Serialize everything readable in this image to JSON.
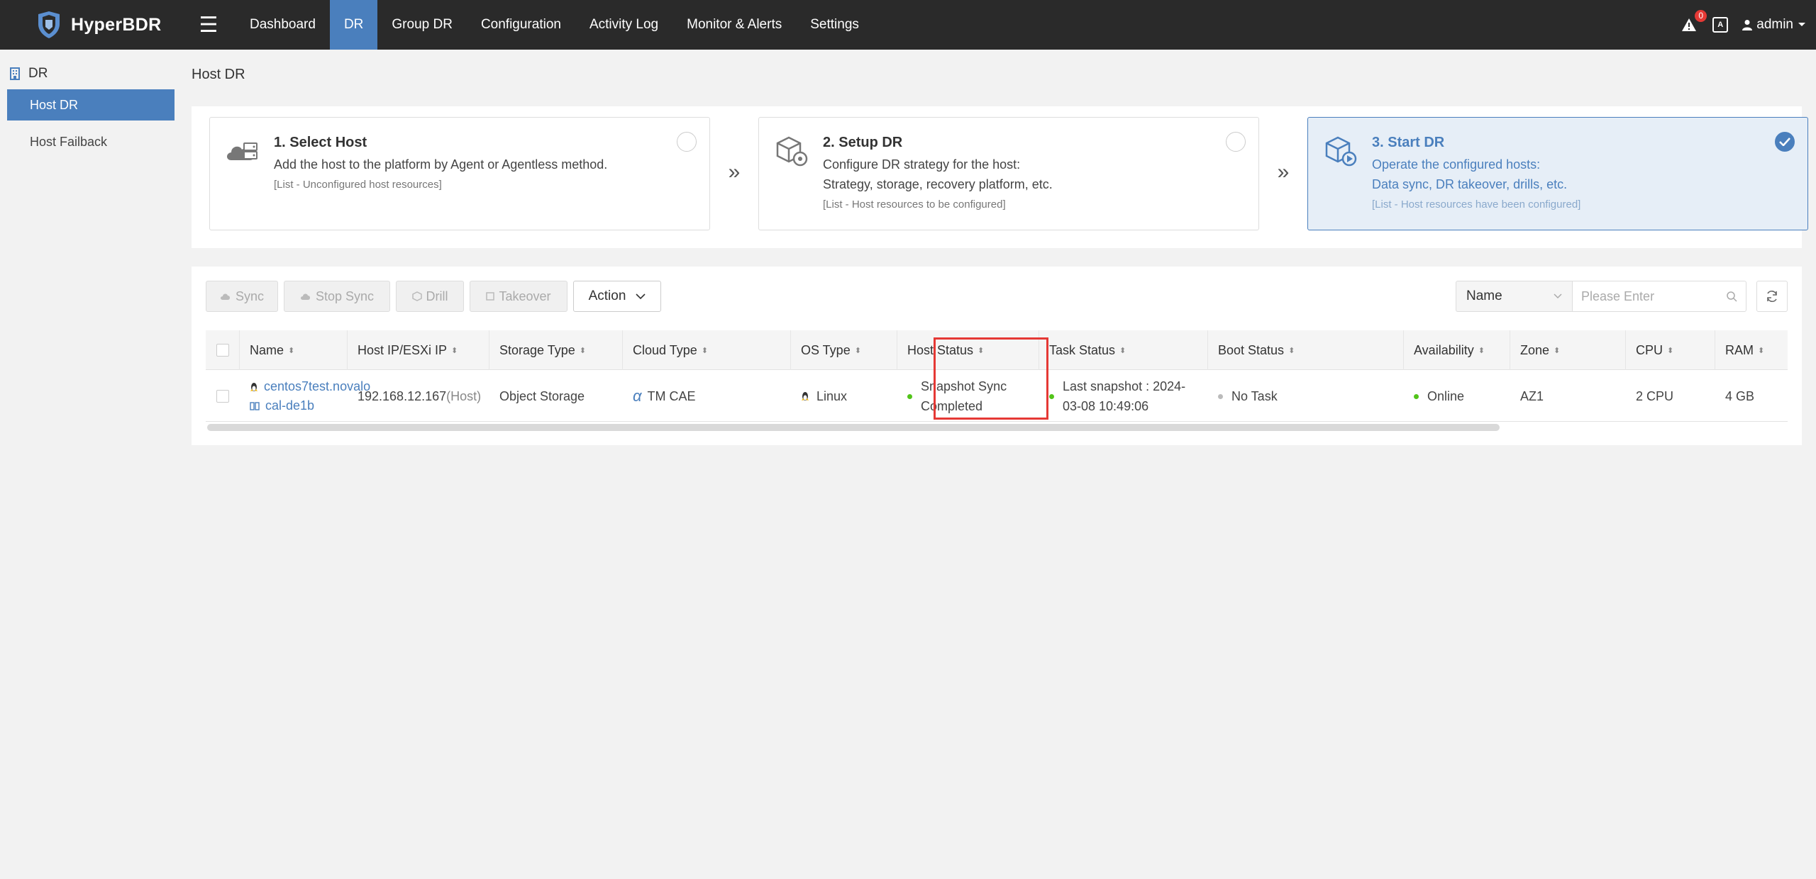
{
  "app": {
    "name": "HyperBDR"
  },
  "nav": {
    "items": [
      {
        "label": "Dashboard",
        "active": false
      },
      {
        "label": "DR",
        "active": true
      },
      {
        "label": "Group DR",
        "active": false
      },
      {
        "label": "Configuration",
        "active": false
      },
      {
        "label": "Activity Log",
        "active": false
      },
      {
        "label": "Monitor & Alerts",
        "active": false
      },
      {
        "label": "Settings",
        "active": false
      }
    ]
  },
  "topbar": {
    "alert_count": "0",
    "lang_icon": "A",
    "user": "admin"
  },
  "sidebar": {
    "section": "DR",
    "items": [
      {
        "label": "Host DR",
        "active": true
      },
      {
        "label": "Host Failback",
        "active": false
      }
    ]
  },
  "page": {
    "title": "Host DR"
  },
  "steps": [
    {
      "title": "1. Select Host",
      "desc1": "Add the host to the platform by Agent or Agentless method.",
      "desc2": "",
      "note": "[List - Unconfigured host resources]",
      "checked": false
    },
    {
      "title": "2. Setup DR",
      "desc1": "Configure DR strategy for the host:",
      "desc2": "Strategy, storage, recovery platform, etc.",
      "note": "[List - Host resources to be configured]",
      "checked": false
    },
    {
      "title": "3. Start DR",
      "desc1": "Operate the configured hosts:",
      "desc2": "Data sync, DR takeover, drills, etc.",
      "note": "[List - Host resources have been configured]",
      "checked": true
    }
  ],
  "toolbar": {
    "sync": "Sync",
    "stop_sync": "Stop Sync",
    "drill": "Drill",
    "takeover": "Takeover",
    "action": "Action",
    "search_field": "Name",
    "search_placeholder": "Please Enter"
  },
  "table": {
    "columns": [
      "Name",
      "Host IP/ESXi IP",
      "Storage Type",
      "Cloud Type",
      "OS Type",
      "Host Status",
      "Task Status",
      "Boot Status",
      "Availability",
      "Zone",
      "CPU",
      "RAM"
    ],
    "rows": [
      {
        "name_line1": "centos7test.novalo",
        "name_line2": "cal-de1b",
        "host_ip": "192.168.12.167",
        "host_ip_suffix": "(Host)",
        "storage_type": "Object Storage",
        "cloud_type": "TM CAE",
        "os_type": "Linux",
        "host_status_line1": "Snapshot Sync",
        "host_status_line2": "Completed",
        "task_status_line1": "Last snapshot : 2024-",
        "task_status_line2": "03-08 10:49:06",
        "boot_status": "No Task",
        "availability": "Online",
        "zone": "AZ1",
        "cpu": "2 CPU",
        "ram": "4 GB"
      }
    ]
  },
  "colors": {
    "brand": "#4a7fbd",
    "topbar": "#2a2a2a",
    "success": "#52c41a",
    "highlight": "#e53935"
  }
}
